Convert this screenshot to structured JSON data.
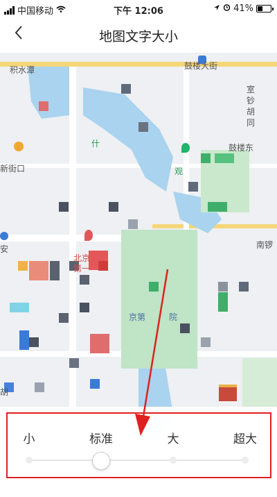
{
  "status_bar": {
    "carrier": "中国移动",
    "time": "下午 12:06",
    "battery": "41%",
    "battery_level": 0.41
  },
  "nav": {
    "back_icon": "chevron-left-icon",
    "title": "地图文字大小"
  },
  "map": {
    "labels": [
      "积水潭",
      "鼓楼大街",
      "室",
      "钞",
      "胡",
      "同",
      "鼓楼东",
      "什",
      "观",
      "新街口",
      "南锣",
      "北京",
      "第一",
      "京第",
      "院",
      "安",
      "胡"
    ]
  },
  "font_size": {
    "options": [
      "小",
      "标准",
      "大",
      "超大"
    ],
    "selected_index": 1
  },
  "colors": {
    "accent_red": "#e02020",
    "water": "#a9d3ee",
    "park": "#bfe4c6",
    "road": "#ffffff"
  }
}
